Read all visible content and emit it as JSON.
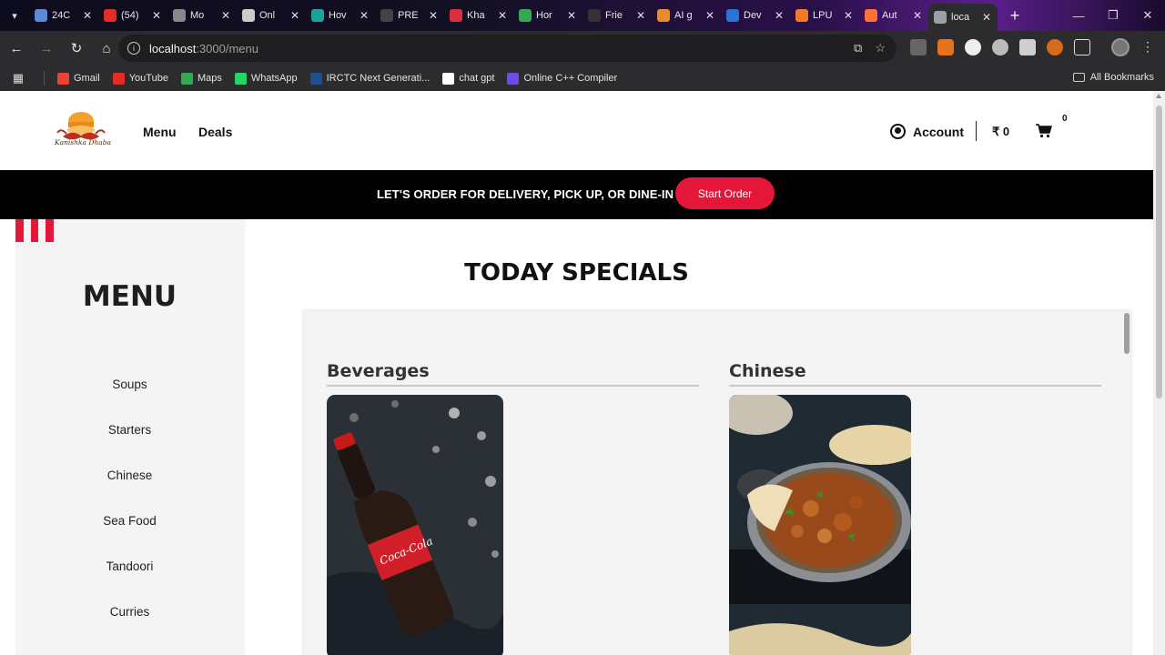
{
  "browser": {
    "tabs": [
      {
        "title": "24C",
        "color": "#5b8ad6"
      },
      {
        "title": "(54)",
        "color": "#e52d27"
      },
      {
        "title": "Mo",
        "color": "#888888"
      },
      {
        "title": "Onl",
        "color": "#cccccc"
      },
      {
        "title": "Hov",
        "color": "#1aa39a"
      },
      {
        "title": "PRE",
        "color": "#444444"
      },
      {
        "title": "Kha",
        "color": "#d9303e"
      },
      {
        "title": "Hor",
        "color": "#34a853"
      },
      {
        "title": "Frie",
        "color": "#333333"
      },
      {
        "title": "AI g",
        "color": "#e88a2d"
      },
      {
        "title": "Dev",
        "color": "#2a74d6"
      },
      {
        "title": "LPU",
        "color": "#f07a2a"
      },
      {
        "title": "Aut",
        "color": "#ff7139"
      },
      {
        "title": "loca",
        "color": "#9aa0a6"
      }
    ],
    "url_host": "localhost",
    "url_path": ":3000/menu",
    "bookmarks": [
      "Gmail",
      "YouTube",
      "Maps",
      "WhatsApp",
      "IRCTC Next Generati...",
      "chat gpt",
      "Online C++ Compiler"
    ],
    "all_bookmarks": "All Bookmarks"
  },
  "header": {
    "logo_text": "Kanishka Dhaba",
    "nav": [
      "Menu",
      "Deals"
    ],
    "account": "Account",
    "cart_total": "₹ 0",
    "cart_count": "0"
  },
  "banner": {
    "text": "LET'S ORDER FOR DELIVERY, PICK UP, OR DINE-IN",
    "button": "Start Order",
    "accent": "#e4163a"
  },
  "sidebar": {
    "title": "MENU",
    "items": [
      "Soups",
      "Starters",
      "Chinese",
      "Sea Food",
      "Tandoori",
      "Curries"
    ]
  },
  "main": {
    "title": "TODAY SPECIALS",
    "categories": [
      {
        "name": "Beverages",
        "image": "coca-cola-bottle-photo"
      },
      {
        "name": "Chinese",
        "image": "curry-dish-photo"
      }
    ]
  }
}
